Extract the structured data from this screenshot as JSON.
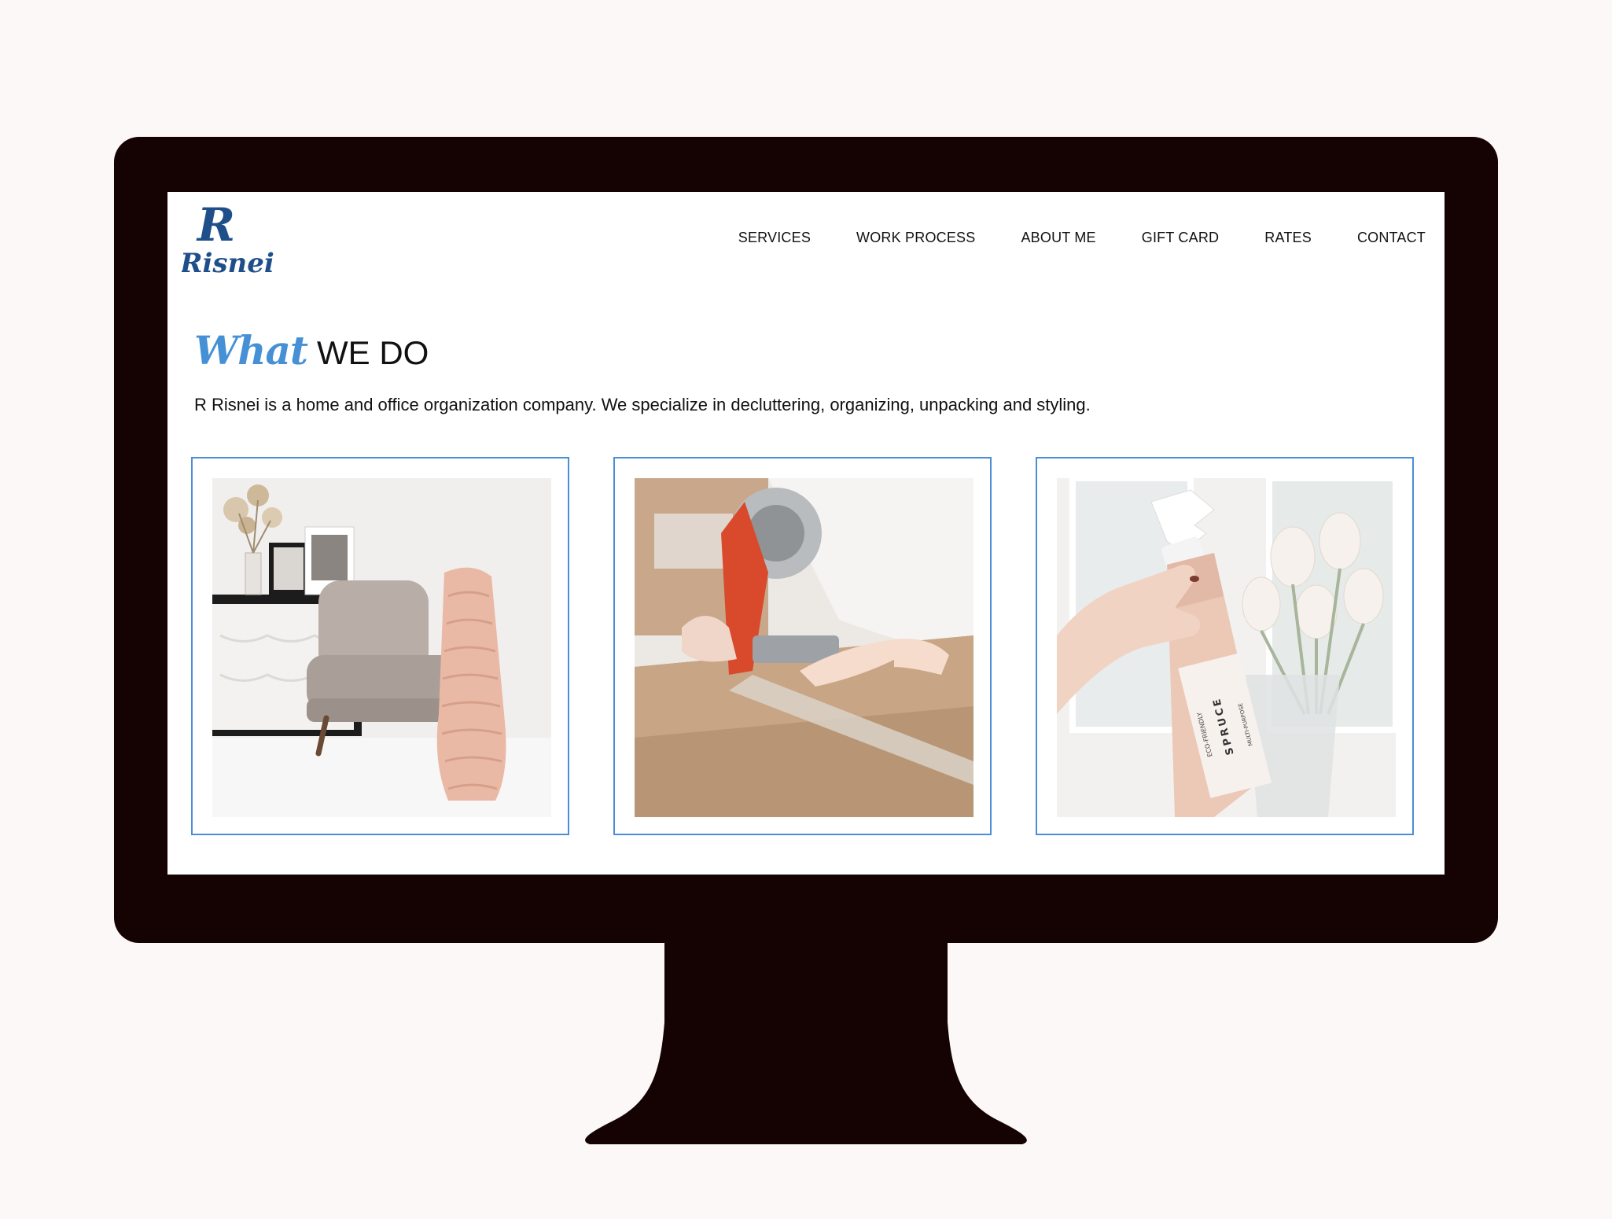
{
  "brand": {
    "logo_initial": "R",
    "logo_name": "Risnei",
    "logo_color": "#1f4f8a"
  },
  "nav": {
    "items": [
      {
        "label": "SERVICES"
      },
      {
        "label": "WORK PROCESS"
      },
      {
        "label": "ABOUT ME"
      },
      {
        "label": "GIFT CARD"
      },
      {
        "label": "RATES"
      },
      {
        "label": "CONTACT"
      }
    ]
  },
  "section": {
    "title_script": "What",
    "title_main": "WE DO",
    "description": "R Risnei is a home and office organization company. We specialize in decluttering, organizing, unpacking and styling.",
    "accent_color": "#4690d6"
  },
  "cards": [
    {
      "photo": "armchair-with-knit-blanket-photo"
    },
    {
      "photo": "taping-cardboard-box-photo"
    },
    {
      "photo": "spray-bottle-and-tulips-photo"
    }
  ],
  "product_label": {
    "line1": "ECO-FRIENDLY",
    "line2": "SPRUCE",
    "line3": "MULTI-PURPOSE"
  }
}
